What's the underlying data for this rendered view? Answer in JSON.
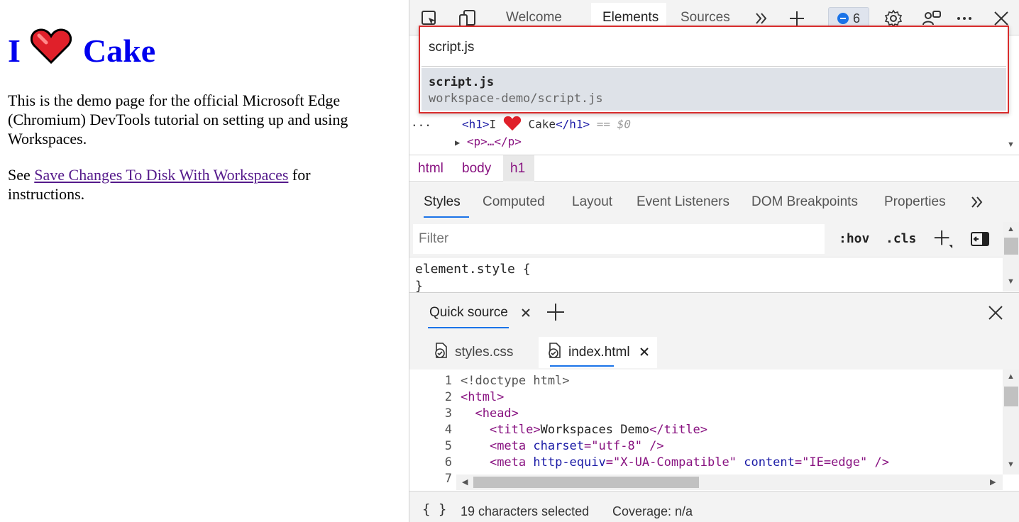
{
  "page": {
    "heading_left": "I",
    "heading_right": "Cake",
    "intro": "This is the demo page for the official Microsoft Edge (Chromium) DevTools tutorial on setting up and using Workspaces.",
    "see_prefix": "See ",
    "link_text": "Save Changes To Disk With Workspaces",
    "see_suffix": " for instructions."
  },
  "devtools": {
    "tabs": [
      "Welcome",
      "Elements",
      "Sources"
    ],
    "active_tab": "Elements",
    "issues_count": "6",
    "dom": {
      "line1_open": "<h1>",
      "line1_text_a": "I",
      "line1_text_b": "Cake",
      "line1_close": "</h1>",
      "line1_marker": "== $0",
      "line2": "<p>…</p>",
      "ellipsis": "..."
    },
    "breadcrumbs": [
      "html",
      "body",
      "h1"
    ],
    "subtabs": [
      "Styles",
      "Computed",
      "Layout",
      "Event Listeners",
      "DOM Breakpoints",
      "Properties"
    ],
    "filter_placeholder": "Filter",
    "hov_label": ":hov",
    "cls_label": ".cls",
    "styles_line1": "element.style {",
    "styles_line2": "}",
    "drawer_tab": "Quick source",
    "file_tabs": [
      "styles.css",
      "index.html"
    ],
    "code_lines": [
      {
        "n": "1",
        "parts": [
          [
            "c-doc",
            "<!doctype html>"
          ]
        ]
      },
      {
        "n": "2",
        "parts": [
          [
            "c-tag",
            "<html>"
          ]
        ]
      },
      {
        "n": "3",
        "parts": [
          [
            "",
            "  "
          ],
          [
            "c-tag",
            "<head>"
          ]
        ]
      },
      {
        "n": "4",
        "parts": [
          [
            "",
            "    "
          ],
          [
            "c-tag",
            "<title>"
          ],
          [
            "",
            "Workspaces Demo"
          ],
          [
            "c-tag",
            "</title>"
          ]
        ]
      },
      {
        "n": "5",
        "parts": [
          [
            "",
            "    "
          ],
          [
            "c-tag",
            "<meta "
          ],
          [
            "c-attrname",
            "charset"
          ],
          [
            "c-tag",
            "="
          ],
          [
            "c-val",
            "\"utf-8\""
          ],
          [
            "c-tag",
            " />"
          ]
        ]
      },
      {
        "n": "6",
        "parts": [
          [
            "",
            "    "
          ],
          [
            "c-tag",
            "<meta "
          ],
          [
            "c-attrname",
            "http-equiv"
          ],
          [
            "c-tag",
            "="
          ],
          [
            "c-val",
            "\"X-UA-Compatible\""
          ],
          [
            "",
            " "
          ],
          [
            "c-attrname",
            "content"
          ],
          [
            "c-tag",
            "="
          ],
          [
            "c-val",
            "\"IE=edge\""
          ],
          [
            "c-tag",
            " />"
          ]
        ]
      },
      {
        "n": "7",
        "parts": []
      }
    ],
    "status_braces": "{ }",
    "status_selected": "19 characters selected",
    "status_coverage": "Coverage: n/a",
    "quickopen": {
      "query": "script.js",
      "result_title": "script.js",
      "result_path": "workspace-demo/script.js"
    },
    "colors": {
      "accent": "#1a73e8",
      "highlight_border": "#d82c2c",
      "heart": "#e0202a"
    }
  }
}
